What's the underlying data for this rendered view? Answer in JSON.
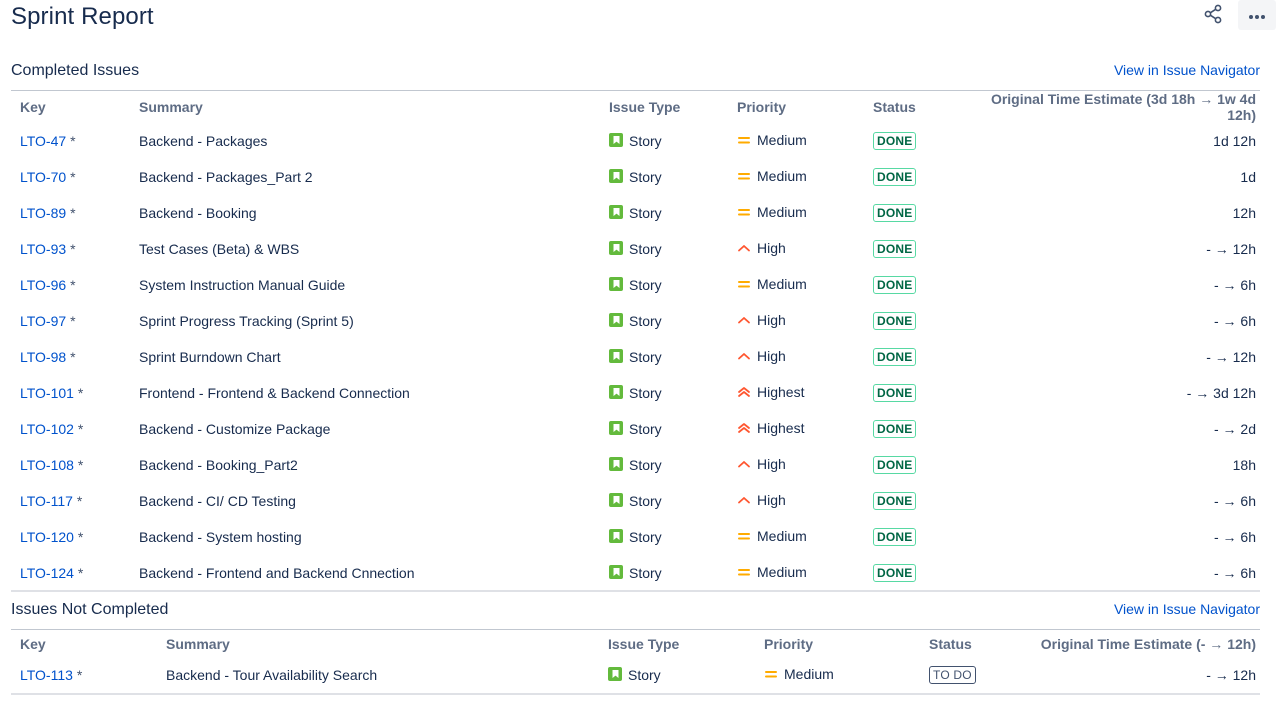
{
  "page": {
    "title": "Sprint Report"
  },
  "completed": {
    "title": "Completed Issues",
    "nav_link": "View in Issue Navigator",
    "headers": {
      "key": "Key",
      "summary": "Summary",
      "type": "Issue Type",
      "priority": "Priority",
      "status": "Status",
      "estimate": "Original Time Estimate (3d 18h → 1w 4d 12h)"
    },
    "rows": [
      {
        "key": "LTO-47",
        "star": "*",
        "summary": "Backend - Packages",
        "type": "Story",
        "priority": "Medium",
        "priority_icon": "medium",
        "status": "DONE",
        "estimate": "1d 12h"
      },
      {
        "key": "LTO-70",
        "star": "*",
        "summary": "Backend - Packages_Part 2",
        "type": "Story",
        "priority": "Medium",
        "priority_icon": "medium",
        "status": "DONE",
        "estimate": "1d"
      },
      {
        "key": "LTO-89",
        "star": "*",
        "summary": "Backend - Booking",
        "type": "Story",
        "priority": "Medium",
        "priority_icon": "medium",
        "status": "DONE",
        "estimate": "12h"
      },
      {
        "key": "LTO-93",
        "star": "*",
        "summary": "Test Cases (Beta) & WBS",
        "type": "Story",
        "priority": "High",
        "priority_icon": "high",
        "status": "DONE",
        "estimate": "- → 12h"
      },
      {
        "key": "LTO-96",
        "star": "*",
        "summary": "System Instruction Manual Guide",
        "type": "Story",
        "priority": "Medium",
        "priority_icon": "medium",
        "status": "DONE",
        "estimate": "- → 6h"
      },
      {
        "key": "LTO-97",
        "star": "*",
        "summary": "Sprint Progress Tracking (Sprint 5)",
        "type": "Story",
        "priority": "High",
        "priority_icon": "high",
        "status": "DONE",
        "estimate": "- → 6h"
      },
      {
        "key": "LTO-98",
        "star": "*",
        "summary": "Sprint Burndown Chart",
        "type": "Story",
        "priority": "High",
        "priority_icon": "high",
        "status": "DONE",
        "estimate": "- → 12h"
      },
      {
        "key": "LTO-101",
        "star": "*",
        "summary": "Frontend - Frontend & Backend Connection",
        "type": "Story",
        "priority": "Highest",
        "priority_icon": "highest",
        "status": "DONE",
        "estimate": "- → 3d 12h"
      },
      {
        "key": "LTO-102",
        "star": "*",
        "summary": "Backend - Customize Package",
        "type": "Story",
        "priority": "Highest",
        "priority_icon": "highest",
        "status": "DONE",
        "estimate": "- → 2d"
      },
      {
        "key": "LTO-108",
        "star": "*",
        "summary": "Backend - Booking_Part2",
        "type": "Story",
        "priority": "High",
        "priority_icon": "high",
        "status": "DONE",
        "estimate": "18h"
      },
      {
        "key": "LTO-117",
        "star": "*",
        "summary": "Backend - CI/ CD Testing",
        "type": "Story",
        "priority": "High",
        "priority_icon": "high",
        "status": "DONE",
        "estimate": "- → 6h"
      },
      {
        "key": "LTO-120",
        "star": "*",
        "summary": "Backend - System hosting",
        "type": "Story",
        "priority": "Medium",
        "priority_icon": "medium",
        "status": "DONE",
        "estimate": "- → 6h"
      },
      {
        "key": "LTO-124",
        "star": "*",
        "summary": "Backend - Frontend and Backend Cnnection",
        "type": "Story",
        "priority": "Medium",
        "priority_icon": "medium",
        "status": "DONE",
        "estimate": "- → 6h"
      }
    ]
  },
  "not_completed": {
    "title": "Issues Not Completed",
    "nav_link": "View in Issue Navigator",
    "headers": {
      "key": "Key",
      "summary": "Summary",
      "type": "Issue Type",
      "priority": "Priority",
      "status": "Status",
      "estimate": "Original Time Estimate (- → 12h)"
    },
    "rows": [
      {
        "key": "LTO-113",
        "star": "*",
        "summary": "Backend - Tour Availability Search",
        "type": "Story",
        "priority": "Medium",
        "priority_icon": "medium",
        "status": "TO DO",
        "estimate": "- → 12h"
      }
    ]
  },
  "colors": {
    "link": "#0052cc",
    "story": "#63ba3c",
    "priority_medium": "#ffab00",
    "priority_high": "#ff5630",
    "done_text": "#006644",
    "done_border": "#57d9a3"
  },
  "icons": {
    "share": "share-icon",
    "more": "more-options-icon",
    "story": "story-icon",
    "medium": "priority-medium-icon",
    "high": "priority-high-icon",
    "highest": "priority-highest-icon"
  }
}
